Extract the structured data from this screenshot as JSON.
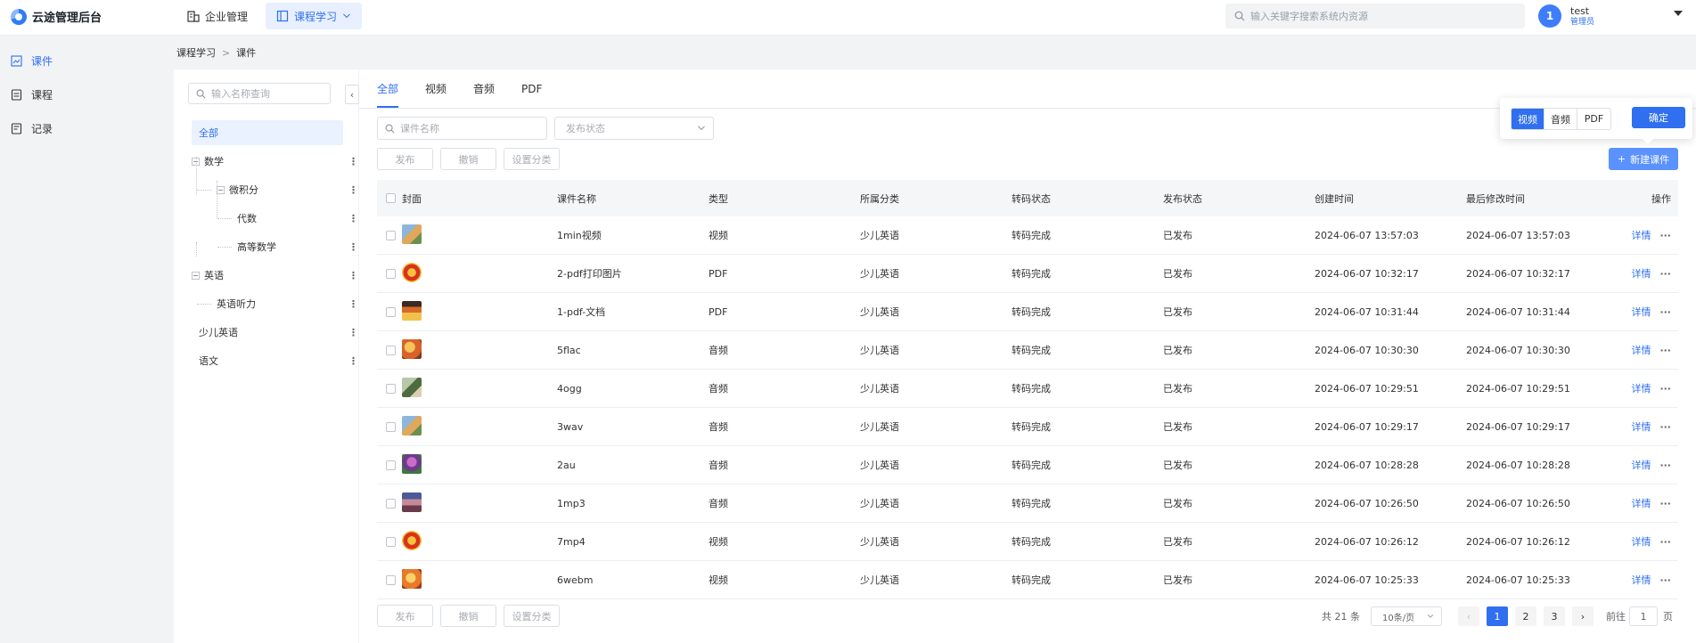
{
  "app": {
    "title": "云途管理后台"
  },
  "topnav": [
    {
      "label": "企业管理",
      "icon": "building-icon"
    },
    {
      "label": "课程学习",
      "icon": "book-icon"
    }
  ],
  "global_search": {
    "placeholder": "输入关键字搜索系统内资源"
  },
  "user": {
    "avatar_text": "1",
    "name": "test",
    "role": "管理员"
  },
  "sidebar": {
    "items": [
      {
        "label": "课件",
        "icon": "courseware-icon"
      },
      {
        "label": "课程",
        "icon": "course-icon"
      },
      {
        "label": "记录",
        "icon": "record-icon"
      }
    ]
  },
  "breadcrumb": {
    "parent": "课程学习",
    "sep": ">",
    "current": "课件"
  },
  "tree": {
    "search_placeholder": "输入名称查询",
    "root": "全部",
    "nodes": {
      "math": "数学",
      "calculus": "微积分",
      "algebra": "代数",
      "advanced_math": "高等数学",
      "english": "英语",
      "listening": "英语听力",
      "kids_english": "少儿英语",
      "chinese": "语文"
    },
    "more": "⋮"
  },
  "tabs": [
    "全部",
    "视频",
    "音频",
    "PDF"
  ],
  "filters": {
    "name_placeholder": "课件名称",
    "status_placeholder": "发布状态"
  },
  "actions": {
    "publish": "发布",
    "revoke": "撤销",
    "set_category": "设置分类",
    "new": "新建课件"
  },
  "popover": {
    "options": [
      "视频",
      "音频",
      "PDF"
    ],
    "confirm": "确定"
  },
  "table": {
    "headers": {
      "cover": "封面",
      "name": "课件名称",
      "type": "类型",
      "category": "所属分类",
      "transcode": "转码状态",
      "publish": "发布状态",
      "created": "创建时间",
      "modified": "最后修改时间",
      "ops": "操作"
    },
    "op_label": "详情",
    "op_more": "···",
    "rows": [
      {
        "name": "1min视频",
        "type": "视频",
        "category": "少儿英语",
        "transcode": "转码完成",
        "publish": "已发布",
        "created": "2024-06-07 13:57:03",
        "modified": "2024-06-07 13:57:03"
      },
      {
        "name": "2-pdf打印图片",
        "type": "PDF",
        "category": "少儿英语",
        "transcode": "转码完成",
        "publish": "已发布",
        "created": "2024-06-07 10:32:17",
        "modified": "2024-06-07 10:32:17"
      },
      {
        "name": "1-pdf-文档",
        "type": "PDF",
        "category": "少儿英语",
        "transcode": "转码完成",
        "publish": "已发布",
        "created": "2024-06-07 10:31:44",
        "modified": "2024-06-07 10:31:44"
      },
      {
        "name": "5flac",
        "type": "音频",
        "category": "少儿英语",
        "transcode": "转码完成",
        "publish": "已发布",
        "created": "2024-06-07 10:30:30",
        "modified": "2024-06-07 10:30:30"
      },
      {
        "name": "4ogg",
        "type": "音频",
        "category": "少儿英语",
        "transcode": "转码完成",
        "publish": "已发布",
        "created": "2024-06-07 10:29:51",
        "modified": "2024-06-07 10:29:51"
      },
      {
        "name": "3wav",
        "type": "音频",
        "category": "少儿英语",
        "transcode": "转码完成",
        "publish": "已发布",
        "created": "2024-06-07 10:29:17",
        "modified": "2024-06-07 10:29:17"
      },
      {
        "name": "2au",
        "type": "音频",
        "category": "少儿英语",
        "transcode": "转码完成",
        "publish": "已发布",
        "created": "2024-06-07 10:28:28",
        "modified": "2024-06-07 10:28:28"
      },
      {
        "name": "1mp3",
        "type": "音频",
        "category": "少儿英语",
        "transcode": "转码完成",
        "publish": "已发布",
        "created": "2024-06-07 10:26:50",
        "modified": "2024-06-07 10:26:50"
      },
      {
        "name": "7mp4",
        "type": "视频",
        "category": "少儿英语",
        "transcode": "转码完成",
        "publish": "已发布",
        "created": "2024-06-07 10:26:12",
        "modified": "2024-06-07 10:26:12"
      },
      {
        "name": "6webm",
        "type": "视频",
        "category": "少儿英语",
        "transcode": "转码完成",
        "publish": "已发布",
        "created": "2024-06-07 10:25:33",
        "modified": "2024-06-07 10:25:33"
      }
    ]
  },
  "pagination": {
    "total": "共 21 条",
    "page_size": "10条/页",
    "pages": [
      "1",
      "2",
      "3"
    ],
    "goto_prefix": "前往",
    "goto_value": "1",
    "goto_suffix": "页"
  },
  "colors": {
    "primary": "#2f6ff0",
    "selected_bg": "#eaf1ff"
  }
}
